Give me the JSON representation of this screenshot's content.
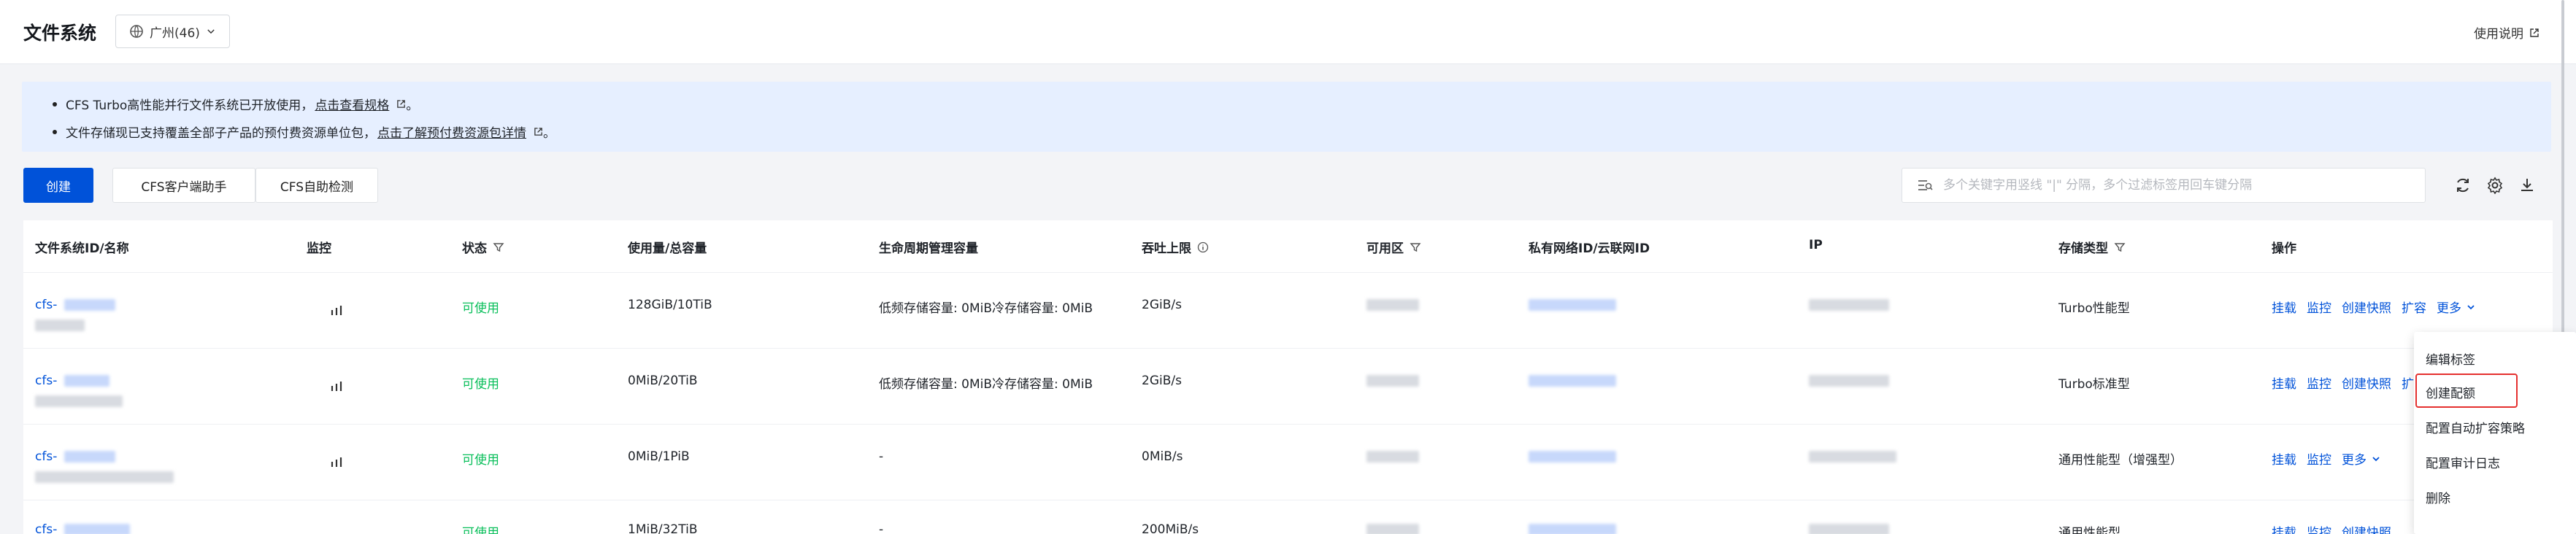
{
  "header": {
    "title": "文件系统",
    "region": "广州(46)",
    "help": "使用说明"
  },
  "notice": {
    "line1_text": "CFS Turbo高性能并行文件系统已开放使用，",
    "line1_link": "点击查看规格",
    "line1_end": "。",
    "line2_text": "文件存储现已支持覆盖全部子产品的预付费资源单位包，",
    "line2_link": "点击了解预付费资源包详情",
    "line2_end": "。"
  },
  "toolbar": {
    "create": "创建",
    "client_helper": "CFS客户端助手",
    "self_check": "CFS自助检测",
    "search_placeholder": "多个关键字用竖线 \"|\" 分隔，多个过滤标签用回车键分隔"
  },
  "columns": {
    "id_name": "文件系统ID/名称",
    "monitor": "监控",
    "status": "状态",
    "usage": "使用量/总容量",
    "lifecycle": "生命周期管理容量",
    "throughput": "吞吐上限",
    "zone": "可用区",
    "vpc": "私有网络ID/云联网ID",
    "ip": "IP",
    "storage_type": "存储类型",
    "ops": "操作"
  },
  "rows": [
    {
      "id": "cfs-",
      "status": "可使用",
      "usage": "128GiB/10TiB",
      "lifecycle": "低频存储容量: 0MiB冷存储容量: 0MiB",
      "throughput": "2GiB/s",
      "storage_type": "Turbo性能型",
      "ops": [
        "挂载",
        "监控",
        "创建快照",
        "扩容",
        "更多"
      ]
    },
    {
      "id": "cfs-",
      "status": "可使用",
      "usage": "0MiB/20TiB",
      "lifecycle": "低频存储容量: 0MiB冷存储容量: 0MiB",
      "throughput": "2GiB/s",
      "storage_type": "Turbo标准型",
      "ops": [
        "挂载",
        "监控",
        "创建快照",
        "扩"
      ]
    },
    {
      "id": "cfs-",
      "status": "可使用",
      "usage": "0MiB/1PiB",
      "lifecycle": "-",
      "throughput": "0MiB/s",
      "storage_type": "通用性能型（增强型）",
      "ops": [
        "挂载",
        "监控",
        "更多"
      ]
    },
    {
      "id": "cfs-",
      "status": "可使用",
      "usage": "1MiB/32TiB",
      "lifecycle": "-",
      "throughput": "200MiB/s",
      "storage_type": "通用性能型",
      "ops": [
        "挂载",
        "监控",
        "创建快照"
      ]
    }
  ],
  "dropdown": {
    "items": [
      "编辑标签",
      "创建配额",
      "配置自动扩容策略",
      "配置审计日志",
      "删除"
    ]
  },
  "colors": {
    "primary": "#0052d9",
    "status_ok": "#0abf5b",
    "highlight": "#e5302f",
    "notice_bg": "#e6efff"
  }
}
